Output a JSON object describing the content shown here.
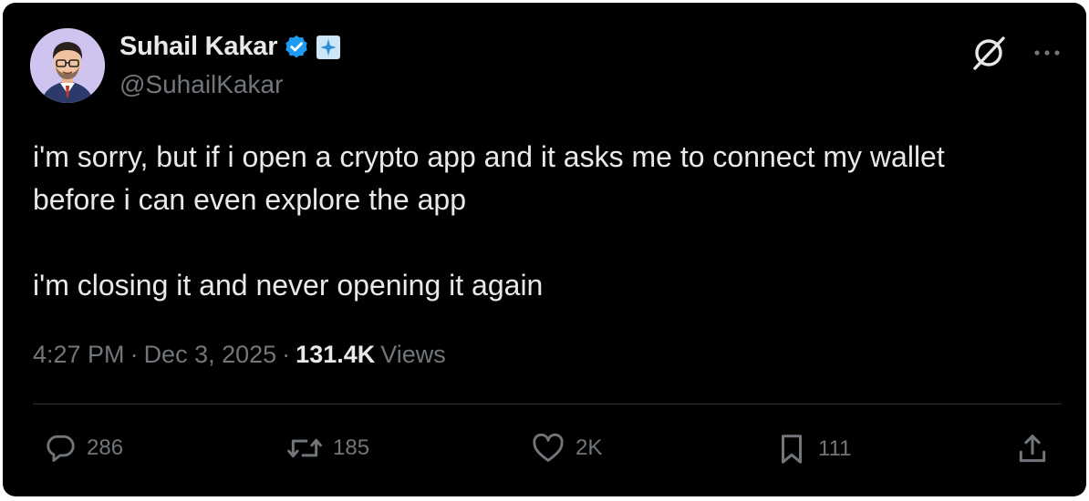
{
  "author": {
    "name": "Suhail Kakar",
    "handle": "@SuhailKakar",
    "verified_color": "#1d9bf0"
  },
  "tweet": {
    "lines": [
      "i'm sorry, but if i open a crypto app and it asks me to connect my wallet",
      "before i can even explore the app",
      "i'm closing it and never opening it again"
    ]
  },
  "meta": {
    "time": "4:27 PM",
    "separator1": "·",
    "date": "Dec 3, 2025",
    "separator2": "·",
    "views_count": "131.4K",
    "views_label": "Views"
  },
  "actions": {
    "replies": "286",
    "reposts": "185",
    "likes": "2K",
    "bookmarks": "111"
  },
  "icons": {
    "reply": "speech-bubble-icon",
    "repost": "repost-arrows-icon",
    "like": "heart-icon",
    "bookmark": "bookmark-icon",
    "share": "share-upload-icon",
    "grok": "grok-icon",
    "more": "more-dots-icon"
  }
}
